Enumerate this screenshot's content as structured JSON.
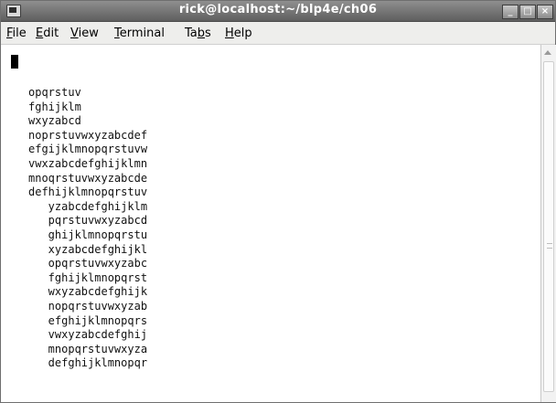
{
  "window": {
    "title": "rick@localhost:~/blp4e/ch06",
    "minimize_symbol": "_",
    "maximize_symbol": "□",
    "close_symbol": "×"
  },
  "menu": {
    "items": [
      {
        "accel": "F",
        "rest": "ile"
      },
      {
        "accel": "E",
        "rest": "dit"
      },
      {
        "accel": "V",
        "rest": "iew"
      },
      {
        "accel": "T",
        "rest": "erminal"
      },
      {
        "accel": "Tabs",
        "rest": "",
        "pre": "Ta",
        "key": "b",
        "post": "s"
      },
      {
        "accel": "H",
        "rest": "elp"
      }
    ]
  },
  "terminal": {
    "lines": [
      "opqrstuv",
      "fghijklm",
      "wxyzabcd",
      "noprstuvwxyzabcdef",
      "efgijklmnopqrstuvw",
      "vwxzabcdefghijklmn",
      "mnoqrstuvwxyzabcde",
      "defhijklmnopqrstuv",
      "   yzabcdefghijklm",
      "   pqrstuvwxyzabcd",
      "   ghijklmnopqrstu",
      "   xyzabcdefghijkl",
      "   opqrstuvwxyzabc",
      "   fghijklmnopqrst",
      "   wxyzabcdefghijk",
      "   nopqrstuvwxyzab",
      "   efghijklmnopqrs",
      "   vwxyzabcdefghij",
      "   mnopqrstuvwxyza",
      "   defghijklmnopqr"
    ]
  }
}
